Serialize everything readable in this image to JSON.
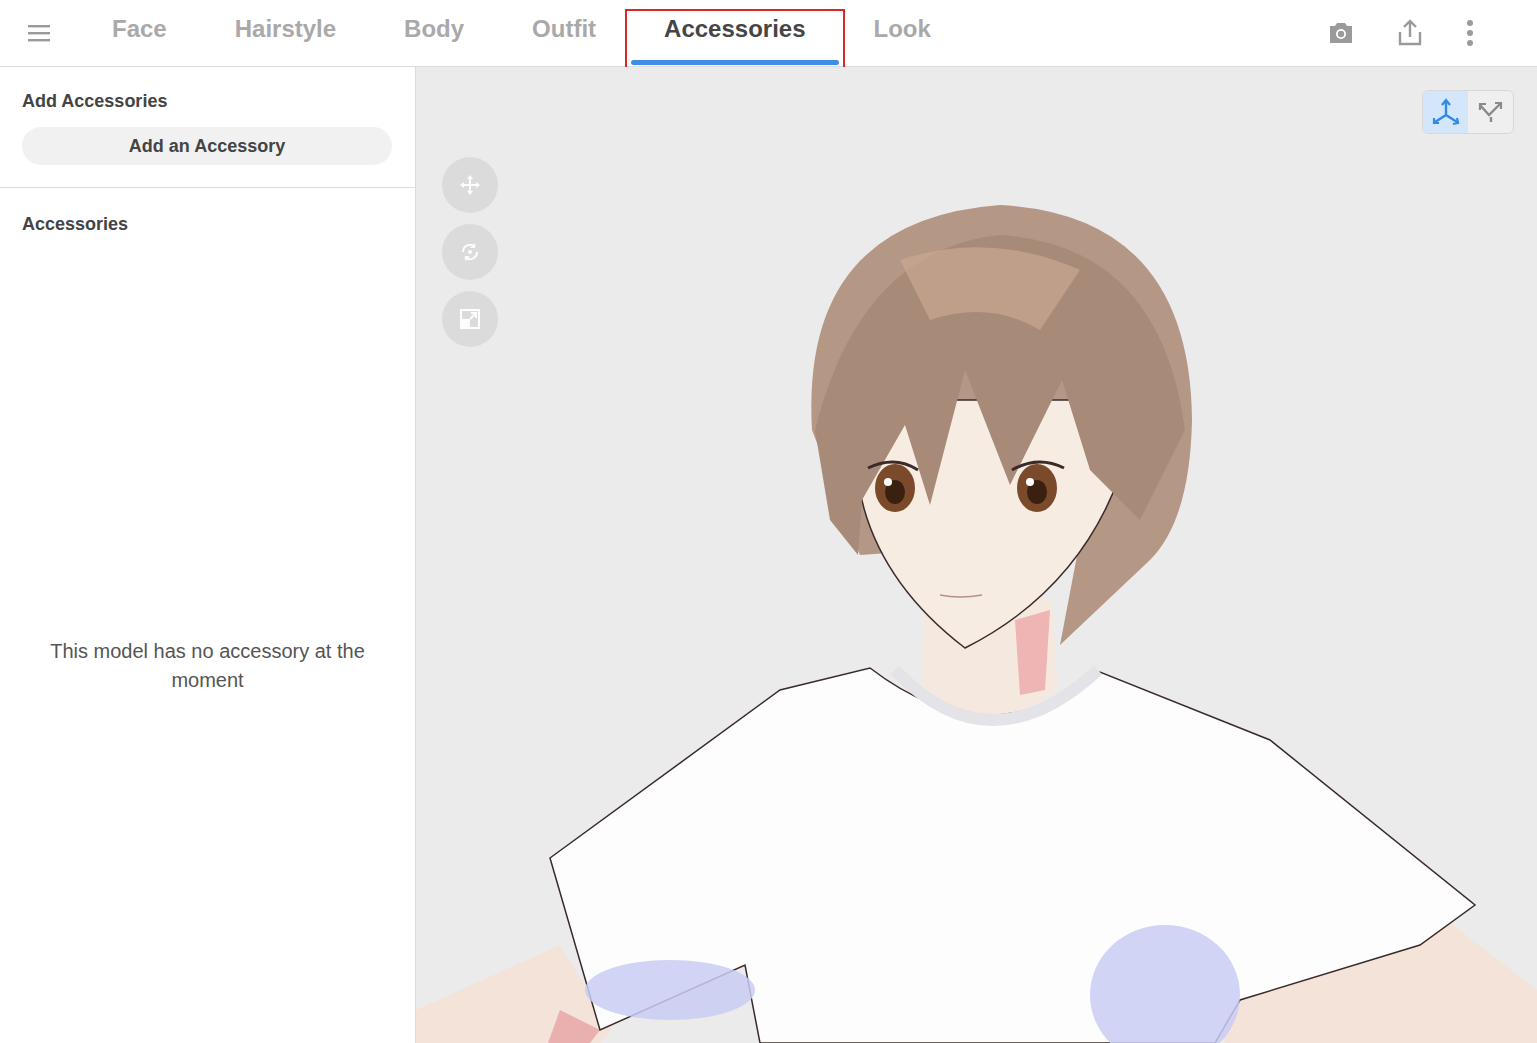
{
  "tabs": [
    {
      "label": "Face",
      "selected": false,
      "highlighted": false
    },
    {
      "label": "Hairstyle",
      "selected": false,
      "highlighted": false
    },
    {
      "label": "Body",
      "selected": false,
      "highlighted": false
    },
    {
      "label": "Outfit",
      "selected": false,
      "highlighted": false
    },
    {
      "label": "Accessories",
      "selected": true,
      "highlighted": true
    },
    {
      "label": "Look",
      "selected": false,
      "highlighted": false
    }
  ],
  "sidebar": {
    "add_section": {
      "title": "Add Accessories",
      "button": "Add an Accessory"
    },
    "list_section": {
      "title": "Accessories",
      "items": [],
      "empty_message": "This model has no accessory at the moment"
    }
  },
  "viewport": {
    "tools": [
      {
        "kind": "move",
        "disabled": true
      },
      {
        "kind": "rotate",
        "disabled": true
      },
      {
        "kind": "scale",
        "disabled": true
      }
    ],
    "view_modes": [
      {
        "kind": "axes",
        "selected": true
      },
      {
        "kind": "free",
        "selected": false
      }
    ]
  }
}
